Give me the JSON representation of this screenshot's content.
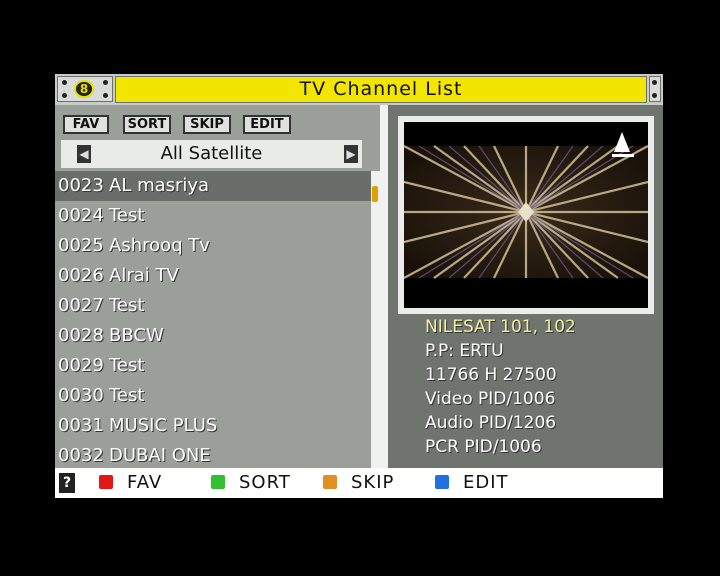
{
  "header": {
    "title": "TV Channel List"
  },
  "filters": [
    {
      "label": "FAV"
    },
    {
      "label": "SORT"
    },
    {
      "label": "SKIP"
    },
    {
      "label": "EDIT"
    }
  ],
  "satellite": {
    "name": "All Satellite"
  },
  "channels": [
    {
      "num": "0023",
      "name": "AL masriya"
    },
    {
      "num": "0024",
      "name": "Test"
    },
    {
      "num": "0025",
      "name": "Ashrooq Tv"
    },
    {
      "num": "0026",
      "name": "Alrai TV"
    },
    {
      "num": "0027",
      "name": "Test"
    },
    {
      "num": "0028",
      "name": "BBCW"
    },
    {
      "num": "0029",
      "name": "Test"
    },
    {
      "num": "0030",
      "name": "Test"
    },
    {
      "num": "0031",
      "name": "MUSIC PLUS"
    },
    {
      "num": "0032",
      "name": "DUBAI ONE"
    }
  ],
  "info": {
    "satellite": "NILESAT 101, 102",
    "provider": "P.P: ERTU",
    "frequency": "11766 H 27500",
    "video_pid": "Video PID/1006",
    "audio_pid": "Audio PID/1206",
    "pcr_pid": "PCR PID/1006"
  },
  "legend": [
    {
      "label": "FAV",
      "color": "#e01818"
    },
    {
      "label": "SORT",
      "color": "#30c030"
    },
    {
      "label": "SKIP",
      "color": "#e09020"
    },
    {
      "label": "EDIT",
      "color": "#2070e0"
    }
  ],
  "icons": {
    "lock": "lock-icon",
    "help": "help-icon"
  }
}
